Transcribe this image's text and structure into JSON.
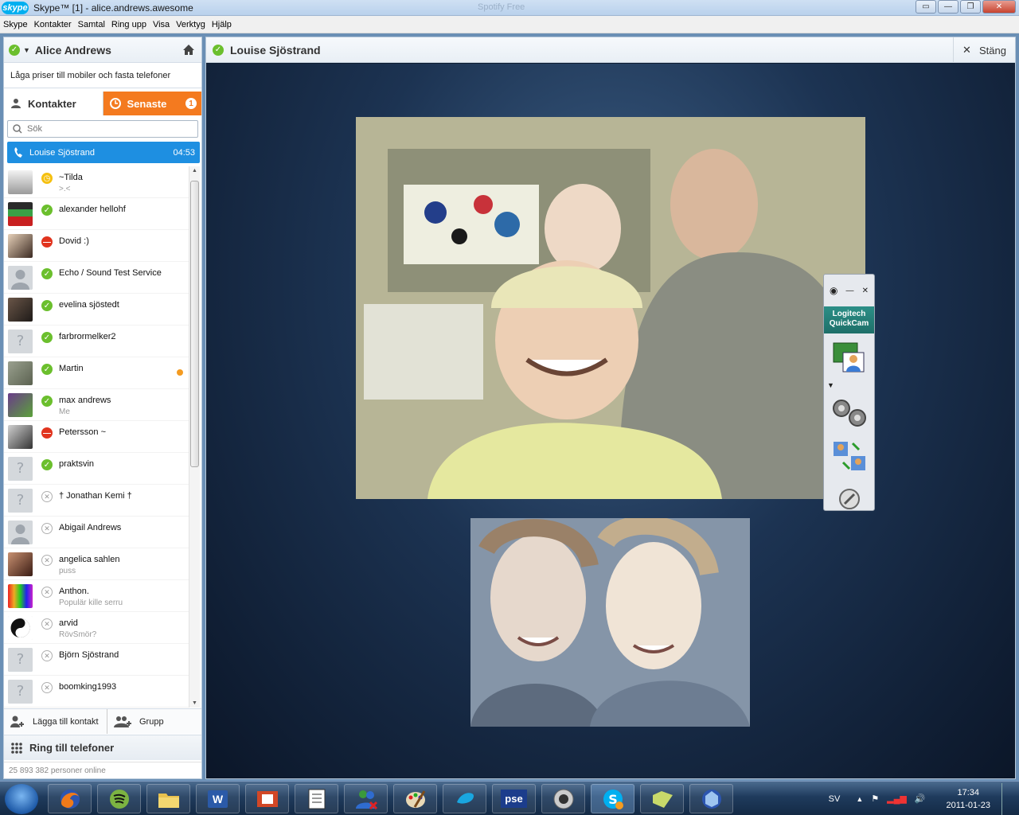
{
  "window": {
    "title": "Skype™ [1] - alice.andrews.awesome",
    "center_title": "Spotify Free",
    "logo_text": "skype"
  },
  "menu": [
    "Skype",
    "Kontakter",
    "Samtal",
    "Ring upp",
    "Visa",
    "Verktyg",
    "Hjälp"
  ],
  "user": {
    "name": "Alice Andrews",
    "promo": "Låga priser till mobiler och fasta telefoner"
  },
  "tabs": {
    "contacts": "Kontakter",
    "recent": "Senaste",
    "recent_badge": "1"
  },
  "search": {
    "placeholder": "Sök"
  },
  "active_call": {
    "name": "Louise Sjöstrand",
    "duration": "04:53"
  },
  "contacts": [
    {
      "name": "~Tilda",
      "mood": ">.<",
      "status": "away"
    },
    {
      "name": "alexander hellohf",
      "mood": "",
      "status": "online"
    },
    {
      "name": "Dovid :)",
      "mood": "",
      "status": "busy"
    },
    {
      "name": "Echo / Sound Test Service",
      "mood": "",
      "status": "online"
    },
    {
      "name": "evelina sjöstedt",
      "mood": "",
      "status": "online"
    },
    {
      "name": "farbrormelker2",
      "mood": "",
      "status": "online"
    },
    {
      "name": "Martin",
      "mood": "",
      "status": "online"
    },
    {
      "name": "max andrews",
      "mood": "Me",
      "status": "online"
    },
    {
      "name": "Petersson ~",
      "mood": "",
      "status": "busy"
    },
    {
      "name": "praktsvin",
      "mood": "",
      "status": "online"
    },
    {
      "name": "† Jonathan Kemi †",
      "mood": "",
      "status": "offline"
    },
    {
      "name": "Abigail Andrews",
      "mood": "",
      "status": "offline"
    },
    {
      "name": "angelica sahlen",
      "mood": "puss",
      "status": "offline"
    },
    {
      "name": "Anthon.",
      "mood": "Populär kille serru",
      "status": "offline"
    },
    {
      "name": "arvid",
      "mood": "RövSmör?",
      "status": "offline"
    },
    {
      "name": "Björn Sjöstrand",
      "mood": "",
      "status": "offline"
    },
    {
      "name": "boomking1993",
      "mood": "",
      "status": "offline"
    }
  ],
  "bottom": {
    "add_contact": "Lägga till kontakt",
    "group": "Grupp",
    "call_phones": "Ring till telefoner",
    "online_count": "25 893 382 personer online"
  },
  "conversation": {
    "name": "Louise Sjöstrand",
    "close_label": "Stäng"
  },
  "quickcam": {
    "title_line1": "Logitech",
    "title_line2": "QuickCam"
  },
  "taskbar": {
    "items": [
      "firefox",
      "spotify",
      "explorer",
      "word",
      "powerpoint",
      "notepad",
      "messenger",
      "paint",
      "telenor",
      "pse",
      "webcam",
      "skype",
      "folder",
      "network"
    ],
    "pse_label": "pse",
    "word_label": "W",
    "lang": "SV",
    "time": "17:34",
    "date": "2011-01-23"
  },
  "colors": {
    "accent_orange": "#f47a1f",
    "active_blue": "#1e8fe1",
    "online_green": "#6bbf2d",
    "away_yellow": "#f5c010",
    "busy_red": "#e1341e"
  }
}
